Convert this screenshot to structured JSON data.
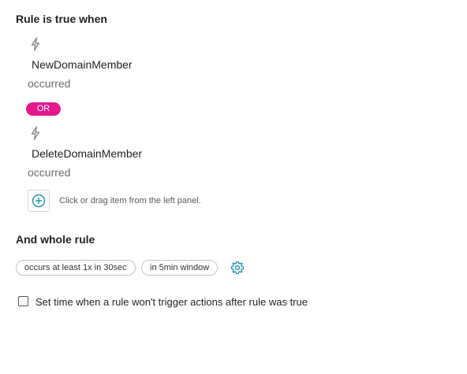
{
  "rule": {
    "title": "Rule is true when",
    "conditions": [
      {
        "name": "NewDomainMember",
        "state": "occurred",
        "icon": "lightning-bolt-icon"
      },
      {
        "name": "DeleteDomainMember",
        "state": "occurred",
        "icon": "lightning-bolt-icon"
      }
    ],
    "operator": "OR",
    "add_hint": "Click or drag item from the left panel.",
    "add_icon": "plus-circle-icon"
  },
  "whole_rule": {
    "title": "And whole rule",
    "chips": [
      "occurs at least 1x in 30sec",
      "in 5min window"
    ],
    "settings_icon": "gear-icon"
  },
  "option": {
    "checkbox_label": "Set time when a rule won't trigger actions after rule was true",
    "checked": false
  },
  "colors": {
    "accent_pink": "#e6178d",
    "accent_teal": "#1a8fb5"
  }
}
